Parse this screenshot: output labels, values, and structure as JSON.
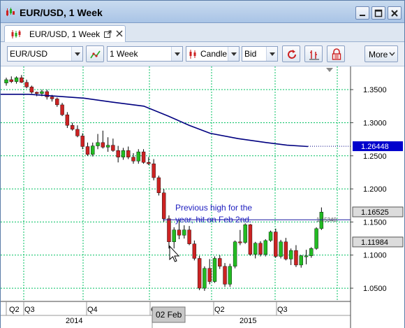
{
  "window": {
    "title": "EUR/USD, 1 Week",
    "controls": [
      "minimize",
      "maximize",
      "close"
    ]
  },
  "tab": {
    "label": "EUR/USD, 1 Week"
  },
  "toolbar": {
    "symbol": "EUR/USD",
    "period": "1 Week",
    "chart_type": "Candle",
    "price_type": "Bid",
    "more_label": "More"
  },
  "chart_data": {
    "type": "candlestick",
    "y_ticks": [
      "1.3500",
      "1.3000",
      "1.2500",
      "1.2000",
      "1.1500",
      "1.1000",
      "1.0500"
    ],
    "y_tick_values": [
      1.35,
      1.3,
      1.25,
      1.2,
      1.15,
      1.1,
      1.05
    ],
    "ylim": [
      1.03,
      1.385
    ],
    "x_quarter_labels": [
      "Q2",
      "Q3",
      "Q4",
      "Q1",
      "Q2",
      "Q3"
    ],
    "x_year_labels": [
      "2014",
      "2015"
    ],
    "crosshair_date_label": "02 Feb",
    "moving_average_label": "1.26448",
    "moving_average_value": 1.26448,
    "price_labels": [
      {
        "text": "1.16525",
        "value": 1.16525
      },
      {
        "text": "1.11984",
        "value": 1.11984
      }
    ],
    "horizontal_line_label": "1.15340",
    "horizontal_line_value": 1.1534,
    "annotation": "Previous high for the year, hit on Feb 2nd.",
    "annotation_lines": [
      "Previous high for the",
      "year, hit on Feb 2nd."
    ],
    "colors": {
      "up": "#22bb22",
      "down": "#cc2222",
      "ma": "#000080",
      "grid": "#00c060",
      "ma_label_bg": "#0000cc"
    },
    "candles": [
      [
        1.36,
        1.368,
        1.356,
        1.365
      ],
      [
        1.365,
        1.37,
        1.36,
        1.362
      ],
      [
        1.362,
        1.37,
        1.359,
        1.368
      ],
      [
        1.368,
        1.372,
        1.36,
        1.361
      ],
      [
        1.361,
        1.365,
        1.352,
        1.354
      ],
      [
        1.354,
        1.356,
        1.344,
        1.346
      ],
      [
        1.346,
        1.347,
        1.34,
        1.344
      ],
      [
        1.344,
        1.35,
        1.34,
        1.347
      ],
      [
        1.347,
        1.35,
        1.335,
        1.339
      ],
      [
        1.339,
        1.342,
        1.332,
        1.336
      ],
      [
        1.336,
        1.338,
        1.324,
        1.327
      ],
      [
        1.327,
        1.33,
        1.31,
        1.312
      ],
      [
        1.312,
        1.316,
        1.292,
        1.296
      ],
      [
        1.296,
        1.3,
        1.288,
        1.29
      ],
      [
        1.29,
        1.296,
        1.278,
        1.28
      ],
      [
        1.28,
        1.284,
        1.26,
        1.264
      ],
      [
        1.264,
        1.27,
        1.25,
        1.252
      ],
      [
        1.252,
        1.27,
        1.249,
        1.265
      ],
      [
        1.265,
        1.283,
        1.26,
        1.27
      ],
      [
        1.27,
        1.288,
        1.261,
        1.263
      ],
      [
        1.263,
        1.278,
        1.256,
        1.266
      ],
      [
        1.266,
        1.276,
        1.256,
        1.258
      ],
      [
        1.258,
        1.265,
        1.24,
        1.248
      ],
      [
        1.248,
        1.262,
        1.244,
        1.258
      ],
      [
        1.258,
        1.264,
        1.245,
        1.248
      ],
      [
        1.248,
        1.254,
        1.238,
        1.242
      ],
      [
        1.242,
        1.26,
        1.238,
        1.256
      ],
      [
        1.256,
        1.26,
        1.238,
        1.24
      ],
      [
        1.24,
        1.248,
        1.236,
        1.238
      ],
      [
        1.238,
        1.245,
        1.213,
        1.217
      ],
      [
        1.217,
        1.22,
        1.19,
        1.194
      ],
      [
        1.194,
        1.2,
        1.15,
        1.155
      ],
      [
        1.155,
        1.16,
        1.11,
        1.12
      ],
      [
        1.12,
        1.142,
        1.11,
        1.138
      ],
      [
        1.138,
        1.153,
        1.124,
        1.13
      ],
      [
        1.13,
        1.145,
        1.125,
        1.138
      ],
      [
        1.138,
        1.144,
        1.115,
        1.117
      ],
      [
        1.117,
        1.122,
        1.092,
        1.095
      ],
      [
        1.095,
        1.099,
        1.047,
        1.05
      ],
      [
        1.05,
        1.083,
        1.046,
        1.08
      ],
      [
        1.08,
        1.094,
        1.056,
        1.06
      ],
      [
        1.06,
        1.098,
        1.058,
        1.095
      ],
      [
        1.095,
        1.1,
        1.079,
        1.083
      ],
      [
        1.083,
        1.088,
        1.052,
        1.056
      ],
      [
        1.056,
        1.087,
        1.052,
        1.083
      ],
      [
        1.083,
        1.122,
        1.08,
        1.12
      ],
      [
        1.12,
        1.138,
        1.115,
        1.119
      ],
      [
        1.119,
        1.148,
        1.117,
        1.146
      ],
      [
        1.146,
        1.147,
        1.099,
        1.101
      ],
      [
        1.101,
        1.12,
        1.095,
        1.118
      ],
      [
        1.118,
        1.121,
        1.098,
        1.101
      ],
      [
        1.101,
        1.124,
        1.098,
        1.122
      ],
      [
        1.122,
        1.137,
        1.12,
        1.135
      ],
      [
        1.135,
        1.14,
        1.096,
        1.098
      ],
      [
        1.098,
        1.123,
        1.095,
        1.12
      ],
      [
        1.12,
        1.126,
        1.092,
        1.094
      ],
      [
        1.094,
        1.11,
        1.085,
        1.107
      ],
      [
        1.107,
        1.115,
        1.082,
        1.085
      ],
      [
        1.085,
        1.1,
        1.081,
        1.099
      ],
      [
        1.099,
        1.108,
        1.086,
        1.099
      ],
      [
        1.099,
        1.112,
        1.096,
        1.11
      ],
      [
        1.11,
        1.142,
        1.108,
        1.14
      ],
      [
        1.14,
        1.172,
        1.138,
        1.165
      ]
    ]
  }
}
